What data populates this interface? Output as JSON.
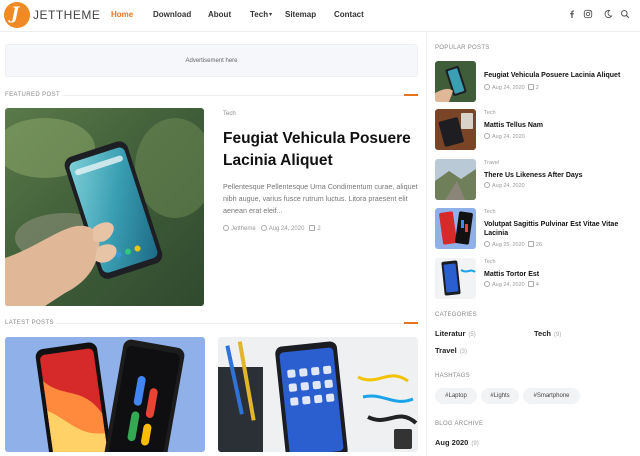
{
  "header": {
    "logo_letter": "J",
    "brand": "JETTHEME",
    "nav": [
      "Home",
      "Download",
      "About",
      "Tech",
      "Sitemap",
      "Contact"
    ],
    "icons": [
      "facebook-icon",
      "instagram-icon",
      "dark-mode-icon",
      "search-icon"
    ]
  },
  "ad": {
    "text": "Advertisement here"
  },
  "featured": {
    "section_title": "FEATURED POST",
    "label": "Tech",
    "title": "Feugiat Vehicula Posuere Lacinia Aliquet",
    "excerpt": "Pellentesque Pellentesque Urna Condimentum curae, aliquet nibh augue, varius fusce rutrum luctus. Litora praesent elit aenean erat eleif...",
    "author": "Jettheme",
    "date": "Aug 24, 2020",
    "comments": "2"
  },
  "latest": {
    "section_title": "LATEST POSTS"
  },
  "sidebar": {
    "popular_title": "POPULAR POSTS",
    "popular": [
      {
        "cat": "",
        "title": "Feugiat Vehicula Posuere Lacinia Aliquet",
        "date": "Aug 24, 2020",
        "comments": "2"
      },
      {
        "cat": "Tech",
        "title": "Mattis Tellus Nam",
        "date": "Aug 24, 2020",
        "comments": ""
      },
      {
        "cat": "Travel",
        "title": "There Us Likeness After Days",
        "date": "Aug 24, 2020",
        "comments": ""
      },
      {
        "cat": "Tech",
        "title": "Volutpat Sagittis Pulvinar Est Vitae Vitae Lacinia",
        "date": "Aug 25, 2020",
        "comments": "26"
      },
      {
        "cat": "Tech",
        "title": "Mattis Tortor Est",
        "date": "Aug 24, 2020",
        "comments": "4"
      }
    ],
    "categories_title": "CATEGORIES",
    "categories": [
      {
        "name": "Literatur",
        "count": "(5)"
      },
      {
        "name": "Tech",
        "count": "(9)"
      },
      {
        "name": "Travel",
        "count": "(3)"
      }
    ],
    "hashtags_title": "HASHTAGS",
    "hashtags": [
      "#Laptop",
      "#Lights",
      "#Smartphone"
    ],
    "archive_title": "BLOG ARCHIVE",
    "archive": {
      "year": "Aug 2020",
      "count": "(9)"
    }
  }
}
